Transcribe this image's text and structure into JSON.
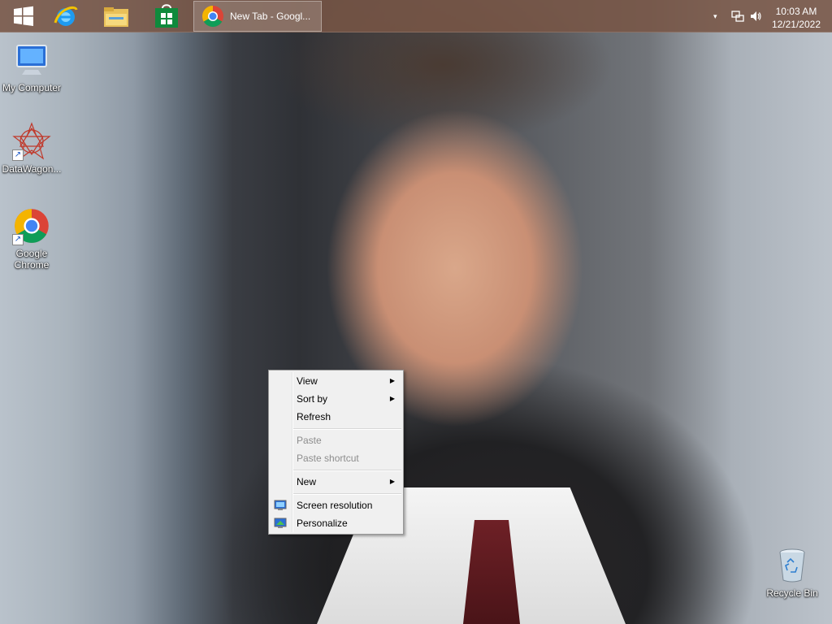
{
  "taskbar": {
    "pinned": [
      {
        "name": "start",
        "icon": "windows-logo-icon"
      },
      {
        "name": "internet-explorer",
        "icon": "internet-explorer-icon"
      },
      {
        "name": "file-explorer",
        "icon": "folder-icon"
      },
      {
        "name": "store",
        "icon": "store-icon"
      }
    ],
    "active_window": {
      "label": "New Tab - Googl...",
      "icon": "chrome-icon"
    },
    "tray": {
      "icons": [
        "chevron-up-icon",
        "network-icon",
        "volume-icon"
      ],
      "time": "10:03 AM",
      "date": "12/21/2022"
    }
  },
  "desktop": {
    "icons": [
      {
        "label": "My Computer",
        "icon": "computer-icon"
      },
      {
        "label": "DataWagon...",
        "icon": "datawagon-icon"
      },
      {
        "label": "Google Chrome",
        "icon": "chrome-icon"
      },
      {
        "label": "Recycle Bin",
        "icon": "recycle-bin-icon"
      }
    ]
  },
  "context_menu": {
    "items": [
      {
        "label": "View",
        "submenu": true,
        "enabled": true
      },
      {
        "label": "Sort by",
        "submenu": true,
        "enabled": true
      },
      {
        "label": "Refresh",
        "submenu": false,
        "enabled": true
      },
      {
        "label": "Paste",
        "submenu": false,
        "enabled": false
      },
      {
        "label": "Paste shortcut",
        "submenu": false,
        "enabled": false
      },
      {
        "label": "New",
        "submenu": true,
        "enabled": true
      },
      {
        "label": "Screen resolution",
        "submenu": false,
        "enabled": true,
        "icon": "screen-resolution-icon"
      },
      {
        "label": "Personalize",
        "submenu": false,
        "enabled": true,
        "icon": "personalize-icon"
      }
    ]
  },
  "colors": {
    "taskbar": "#785546",
    "menu_background": "#f0f0f0",
    "menu_disabled_text": "#8d8d8d"
  }
}
